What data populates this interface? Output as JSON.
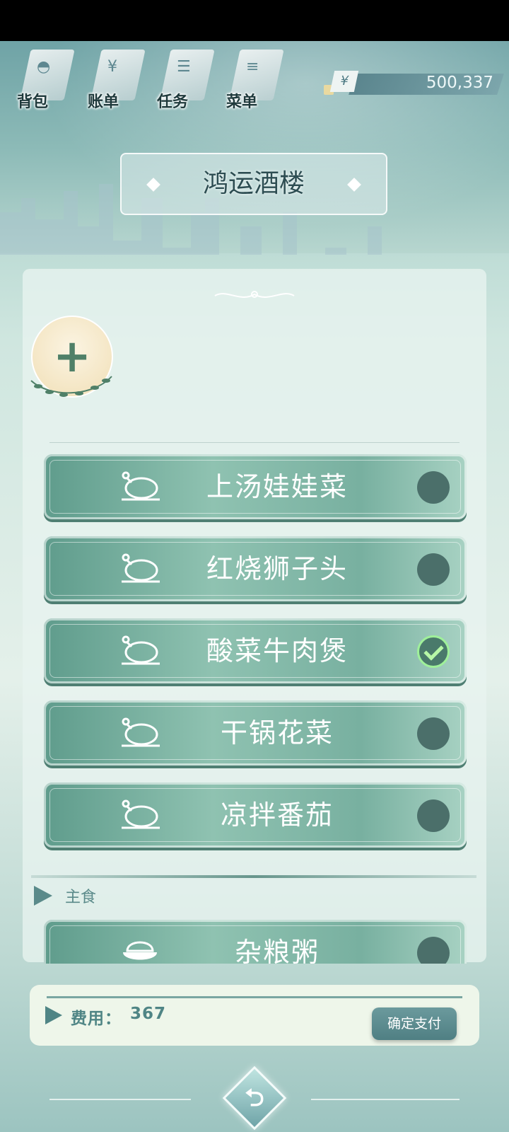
{
  "top_nav": [
    {
      "label": "背包",
      "icon": "bag-icon"
    },
    {
      "label": "账单",
      "icon": "bill-icon"
    },
    {
      "label": "任务",
      "icon": "task-icon"
    },
    {
      "label": "菜单",
      "icon": "menu-icon"
    }
  ],
  "currency": {
    "symbol": "¥",
    "value": "500,337"
  },
  "restaurant": {
    "title": "鸿运酒楼"
  },
  "add_button": {
    "symbol": "+"
  },
  "dishes": [
    {
      "name": "上汤娃娃菜",
      "selected": false,
      "icon": "roast-chicken-icon"
    },
    {
      "name": "红烧狮子头",
      "selected": false,
      "icon": "roast-chicken-icon"
    },
    {
      "name": "酸菜牛肉煲",
      "selected": true,
      "icon": "roast-chicken-icon"
    },
    {
      "name": "干锅花菜",
      "selected": false,
      "icon": "roast-chicken-icon"
    },
    {
      "name": "凉拌番茄",
      "selected": false,
      "icon": "roast-chicken-icon"
    }
  ],
  "staple_section": {
    "label": "主食",
    "items": [
      {
        "name": "杂粮粥",
        "selected": false,
        "icon": "rice-bowl-icon"
      }
    ]
  },
  "footer": {
    "fee_label": "费用：",
    "fee_value": "367",
    "pay_label": "确定支付"
  },
  "colors": {
    "accent": "#5f9c8c",
    "check": "#9ff09a",
    "text_dark": "#2d4d52"
  }
}
